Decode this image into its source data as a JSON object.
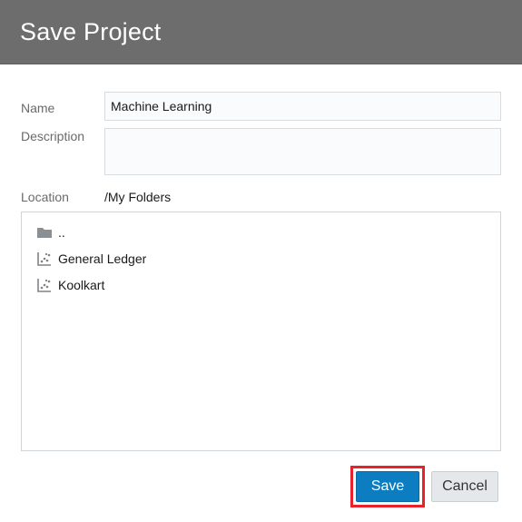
{
  "dialog": {
    "title": "Save Project"
  },
  "form": {
    "name_label": "Name",
    "name_value": "Machine Learning",
    "description_label": "Description",
    "description_value": "",
    "location_label": "Location",
    "location_value": "/My Folders"
  },
  "file_list": {
    "items": [
      {
        "label": "..",
        "icon": "folder-icon"
      },
      {
        "label": "General Ledger",
        "icon": "project-icon"
      },
      {
        "label": "Koolkart",
        "icon": "project-icon"
      }
    ]
  },
  "buttons": {
    "save_label": "Save",
    "cancel_label": "Cancel"
  },
  "colors": {
    "header_bg": "#6d6d6d",
    "primary": "#0d7dc1",
    "highlight": "#e8212b"
  }
}
